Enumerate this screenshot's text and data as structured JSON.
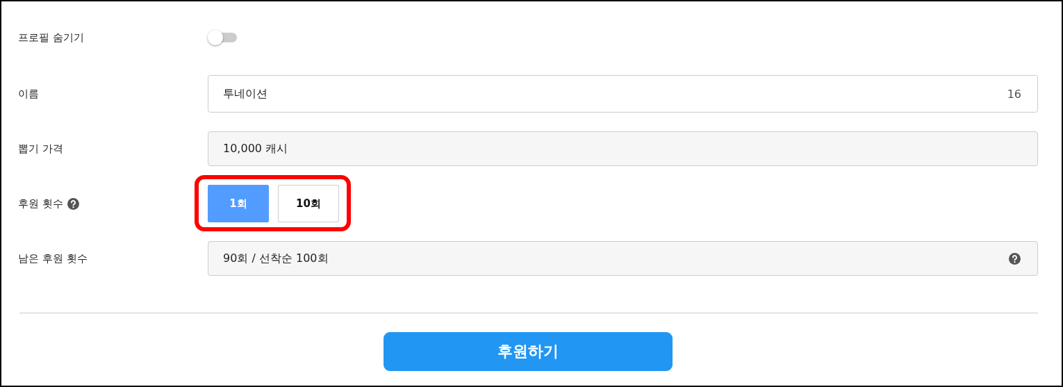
{
  "rows": [
    {
      "kind": "toggle",
      "label": "프로필 숨기기",
      "on": false
    },
    {
      "kind": "input",
      "label": "이름",
      "value": "투네이션",
      "counter": "16"
    },
    {
      "kind": "readonly",
      "label": "뽑기 가격",
      "value": "10,000 캐시"
    },
    {
      "kind": "choice",
      "label": "후원 횟수",
      "help": true,
      "highlighted": true,
      "options": [
        {
          "label": "1회",
          "selected": true
        },
        {
          "label": "10회",
          "selected": false
        }
      ]
    },
    {
      "kind": "readonly",
      "label": "남은 후원 횟수",
      "value": "90회 / 선착순 100회",
      "help": true
    }
  ],
  "submit": "후원하기"
}
